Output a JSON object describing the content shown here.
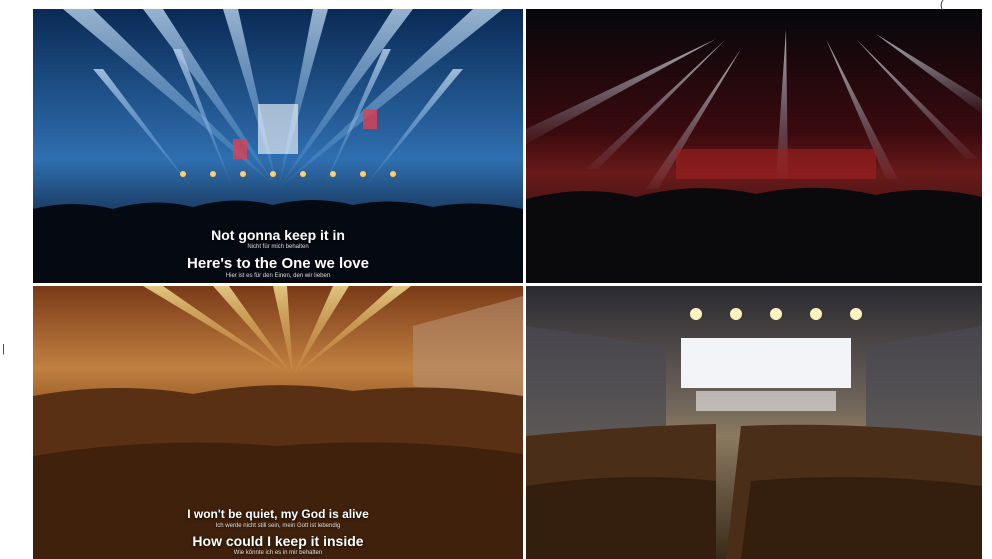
{
  "frames": {
    "top_left": {
      "lyric_1": "Not gonna keep it in",
      "lyric_1_sub": "Nicht für mich behalten",
      "lyric_2": "Here's to the One we love",
      "lyric_2_sub": "Hier ist es für den Einen, den wir lieben"
    },
    "bottom_left": {
      "lyric_1": "I won't be quiet, my God is alive",
      "lyric_1_sub": "Ich werde nicht still sein, mein Gott ist lebendig",
      "lyric_2": "How could I keep it inside",
      "lyric_2_sub": "Wie könnte ich es in mir behalten"
    }
  },
  "edge_marks": {
    "top_right": "(",
    "left": "|"
  },
  "colors": {
    "top_left_tint": "#3a7fc0",
    "top_right_tint": "#c0282a",
    "bottom_left_tint": "#e0a030",
    "bottom_right_tint": "#d8c8a0"
  }
}
